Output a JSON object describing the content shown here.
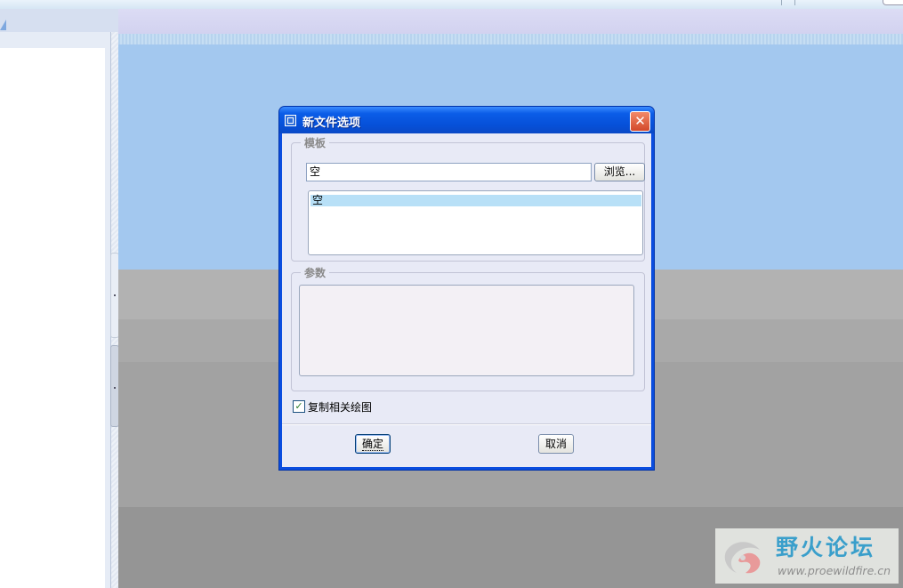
{
  "dialog": {
    "title": "新文件选项",
    "close_icon": "close-icon",
    "template_group": {
      "label": "模板",
      "value": "空",
      "browse_label": "浏览...",
      "list_items": [
        "空"
      ]
    },
    "params_group": {
      "label": "参数"
    },
    "copy_drawings": {
      "label": "复制相关绘图",
      "checked": true
    },
    "ok_label": "确定",
    "cancel_label": "取消"
  },
  "watermark": {
    "name": "野火论坛",
    "url": "www.proewildfire.cn"
  },
  "colors": {
    "titlebar": "#0b5de8",
    "canvas_blue": "#a3c8ef",
    "selection": "#b8e0f7"
  }
}
